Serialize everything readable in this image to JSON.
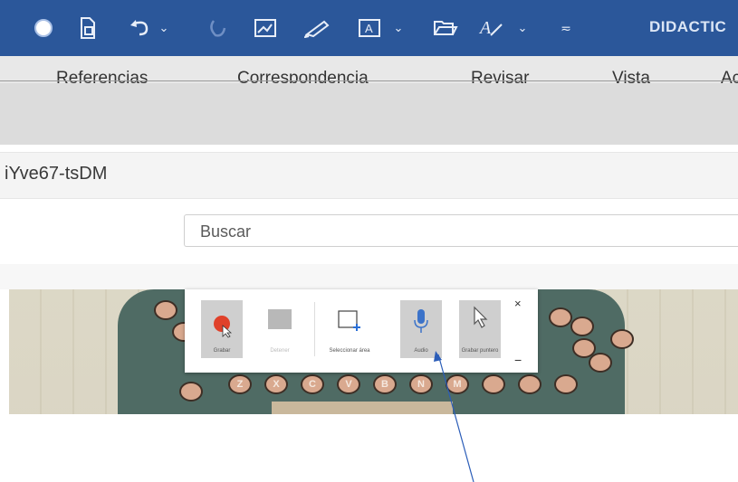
{
  "toolbar": {
    "title": "DIDACTIC",
    "icons": [
      "record-icon",
      "document-icon",
      "undo-icon",
      "chevron-down-icon",
      "redo-icon",
      "edit-image-icon",
      "brush-icon",
      "textbox-icon",
      "chevron-down-icon",
      "folder-open-icon",
      "text-style-icon",
      "chevron-down-icon",
      "customize-icon"
    ]
  },
  "tabs": [
    "Referencias",
    "Correspondencia",
    "Revisar",
    "Vista",
    "Ac"
  ],
  "address": {
    "text": "iYve67-tsDM"
  },
  "search": {
    "placeholder": "Buscar"
  },
  "popup": {
    "buttons": [
      {
        "label": "Grabar"
      },
      {
        "label": "Detener"
      },
      {
        "label": "Seleccionar área"
      },
      {
        "label": "Audio"
      },
      {
        "label": "Grabar puntero"
      }
    ],
    "close_symbol": "×",
    "minimize_symbol": "−"
  },
  "keys": [
    "Z",
    "X",
    "C",
    "V",
    "B",
    "N",
    "M",
    "",
    "",
    ""
  ]
}
